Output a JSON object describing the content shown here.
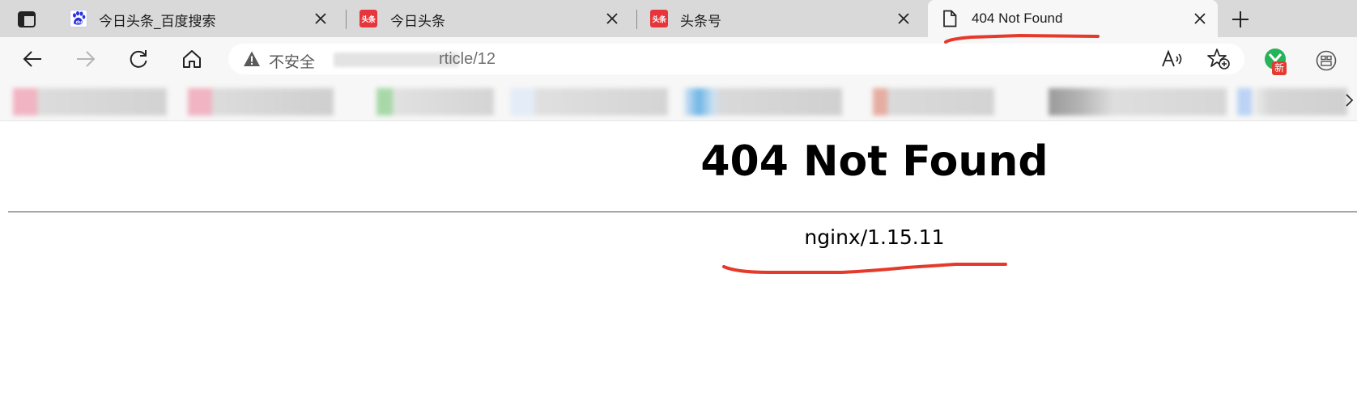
{
  "tabs": [
    {
      "title": "今日头条_百度搜索",
      "favicon": "baidu-paw-icon",
      "active": false
    },
    {
      "title": "今日头条",
      "favicon": "toutiao-icon",
      "favicon_text": "头条",
      "active": false
    },
    {
      "title": "头条号",
      "favicon": "toutiao-icon",
      "favicon_text": "头条",
      "active": false
    },
    {
      "title": "404 Not Found",
      "favicon": "page-icon",
      "active": true
    }
  ],
  "address_bar": {
    "security_label": "不安全",
    "url_visible": "rticle/12"
  },
  "extension": {
    "badge": "新"
  },
  "page": {
    "title": "404 Not Found",
    "server": "nginx/1.15.11"
  },
  "colors": {
    "annotation": "#e53a2b",
    "tabstrip": "#d9d9d9",
    "toolbar": "#f7f7f7",
    "extension_green": "#27b357"
  }
}
